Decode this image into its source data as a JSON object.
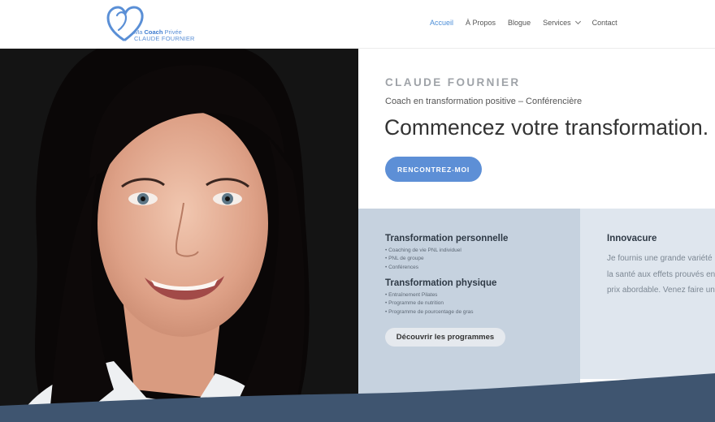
{
  "logo": {
    "line1_prefix": "Ma",
    "line1_coach": "Coach",
    "line1_suffix": "Privée",
    "line2": "CLAUDE FOURNIER",
    "accent_color": "#5a8fd6"
  },
  "nav": {
    "items": [
      {
        "label": "Accueil",
        "active": true
      },
      {
        "label": "À Propos",
        "active": false
      },
      {
        "label": "Blogue",
        "active": false
      },
      {
        "label": "Services",
        "active": false,
        "has_dropdown": true
      },
      {
        "label": "Contact",
        "active": false
      }
    ]
  },
  "hero": {
    "name": "CLAUDE FOURNIER",
    "subtitle": "Coach en transformation positive – Conférencière",
    "title": "Commencez votre transformation.",
    "cta_label": "RENCONTREZ-MOI",
    "cta_color": "#5d8fd6"
  },
  "programs": {
    "sections": [
      {
        "heading": "Transformation personnelle",
        "items": [
          "Coaching de vie PNL individuel",
          "PNL de groupe",
          "Conférences"
        ]
      },
      {
        "heading": "Transformation physique",
        "items": [
          "Entraînement Pilates",
          "Programme de nutrition",
          "Programme de pourcentage de gras"
        ]
      }
    ],
    "button_label": "Découvrir les programmes",
    "background": "#c6d2df"
  },
  "innovacure": {
    "title": "Innovacure",
    "lines": [
      "Je fournis une grande variété",
      "la santé aux effets prouvés en",
      "prix abordable. Venez faire un"
    ]
  },
  "colors": {
    "nav_active": "#4d8fd8",
    "footer_wave": "#3f5570"
  }
}
